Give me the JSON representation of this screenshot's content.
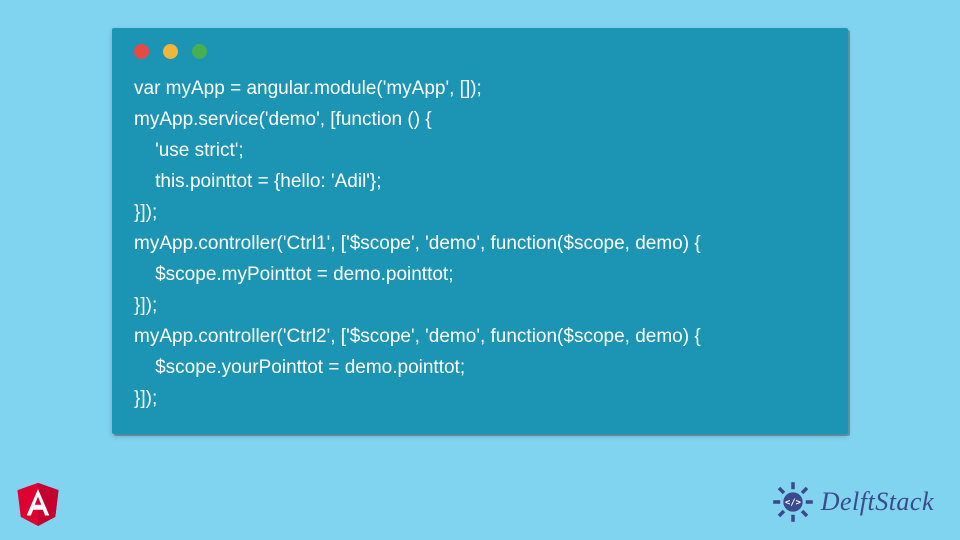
{
  "code": {
    "lines": [
      "var myApp = angular.module('myApp', []);",
      "myApp.service('demo', [function () {",
      "    'use strict';",
      "    this.pointtot = {hello: 'Adil'};",
      "}]);",
      "myApp.controller('Ctrl1', ['$scope', 'demo', function($scope, demo) {",
      "    $scope.myPointtot = demo.pointtot;",
      "}]);",
      "myApp.controller('Ctrl2', ['$scope', 'demo', function($scope, demo) {",
      "    $scope.yourPointtot = demo.pointtot;",
      "}]);"
    ]
  },
  "brand": {
    "name": "DelftStack"
  }
}
